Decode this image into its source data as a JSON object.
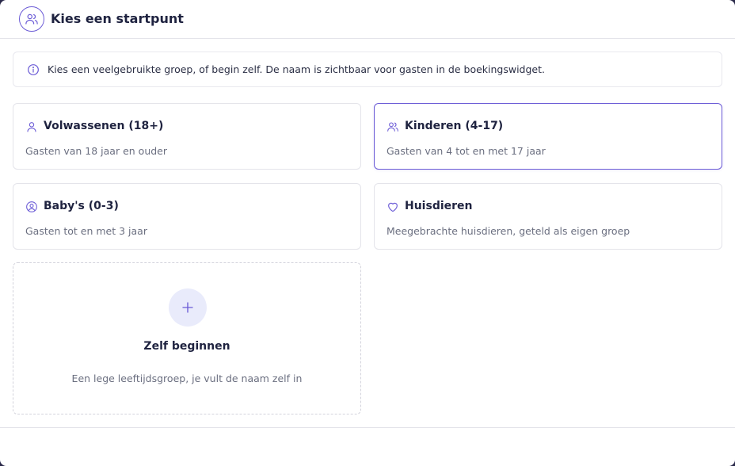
{
  "dialog": {
    "title": "Kies een startpunt",
    "title_icon": "users-icon"
  },
  "info": {
    "icon": "info-icon",
    "text": "Kies een veelgebruikte groep, of begin zelf. De naam is zichtbaar voor gasten in de boekingswidget."
  },
  "options": [
    {
      "icon": "user-icon",
      "title": "Volwassenen (18+)",
      "description": "Gasten van 18 jaar en ouder",
      "selected": false
    },
    {
      "icon": "users-icon",
      "title": "Kinderen (4-17)",
      "description": "Gasten van 4 tot en met 17 jaar",
      "selected": true
    },
    {
      "icon": "baby-icon",
      "title": "Baby's (0-3)",
      "description": "Gasten tot en met 3 jaar",
      "selected": false
    },
    {
      "icon": "heart-icon",
      "title": "Huisdieren",
      "description": "Meegebrachte huisdieren, geteld als eigen groep",
      "selected": false
    }
  ],
  "custom": {
    "icon": "plus-icon",
    "title": "Zelf beginnen",
    "description": "Een lege leeftijdsgroep, je vult de naam zelf in"
  },
  "colors": {
    "accent": "#6b5bd6",
    "text": "#1f2340",
    "muted": "#6b6f80",
    "border": "#e4e4ea",
    "plus_bg": "#e9ebfb"
  }
}
